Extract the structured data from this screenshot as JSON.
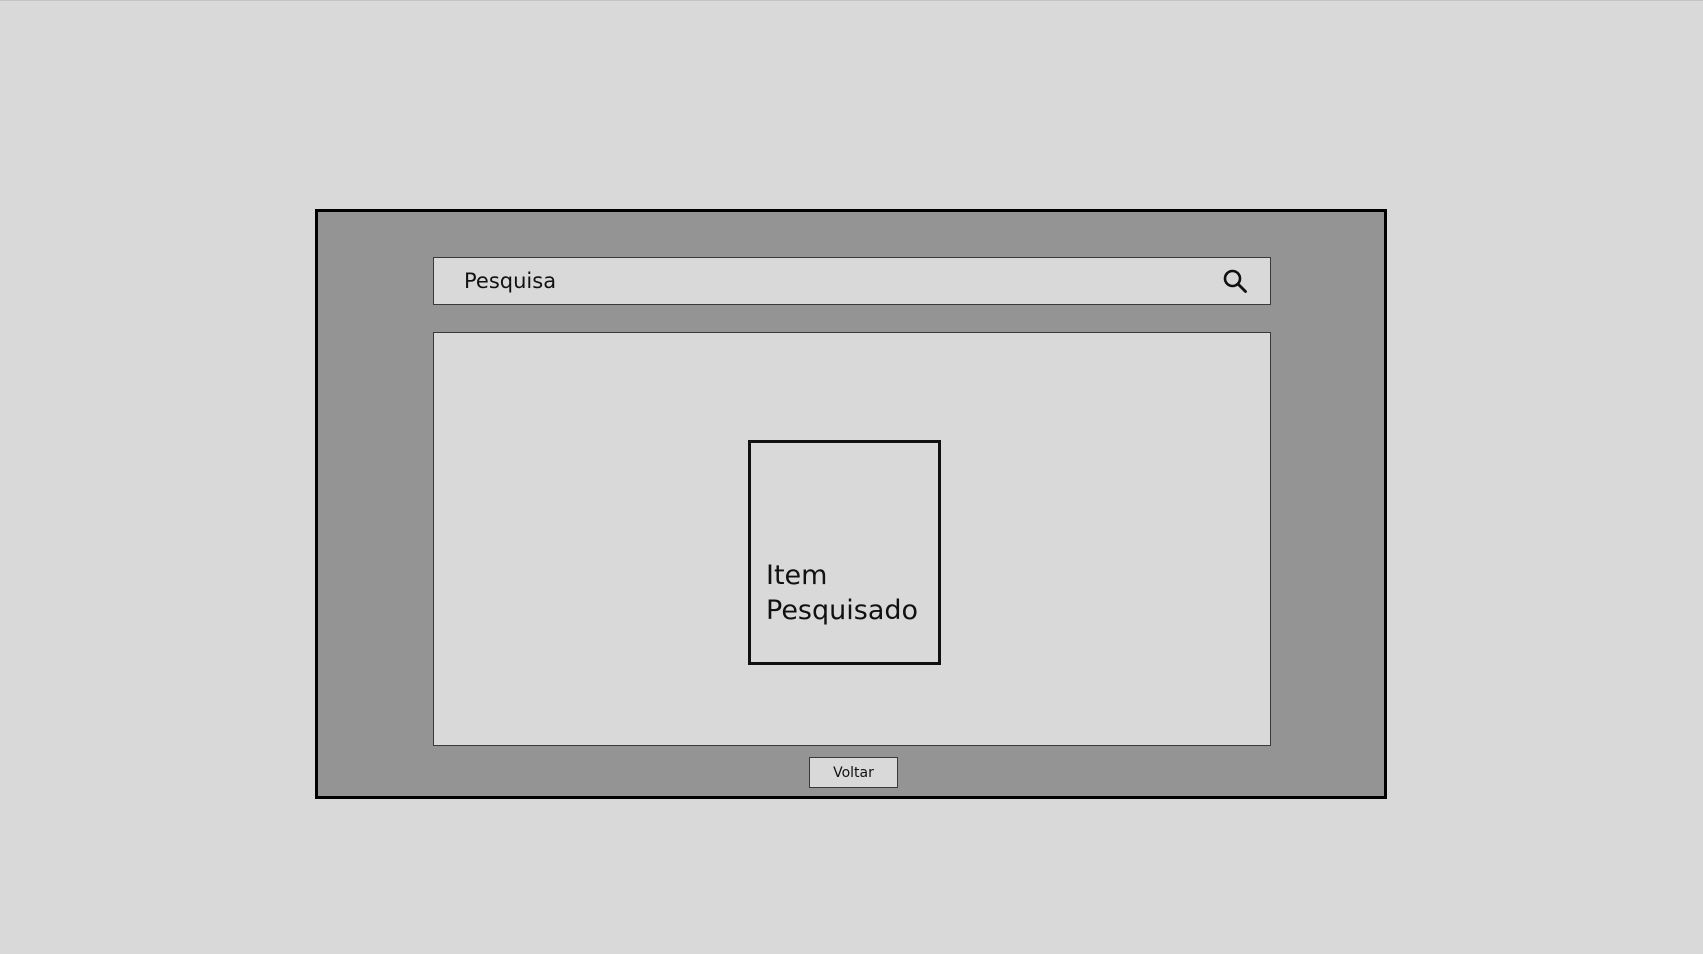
{
  "search": {
    "placeholder": "Pesquisa",
    "value": "",
    "icon": "search-icon"
  },
  "results": {
    "items": [
      {
        "label": "Item Pesquisado"
      }
    ]
  },
  "footer": {
    "back_label": "Voltar"
  },
  "colors": {
    "page_background": "#d9d9d9",
    "window_background": "#949494",
    "window_border": "#000000",
    "panel_background": "#d9d9d9",
    "text": "#111111"
  }
}
